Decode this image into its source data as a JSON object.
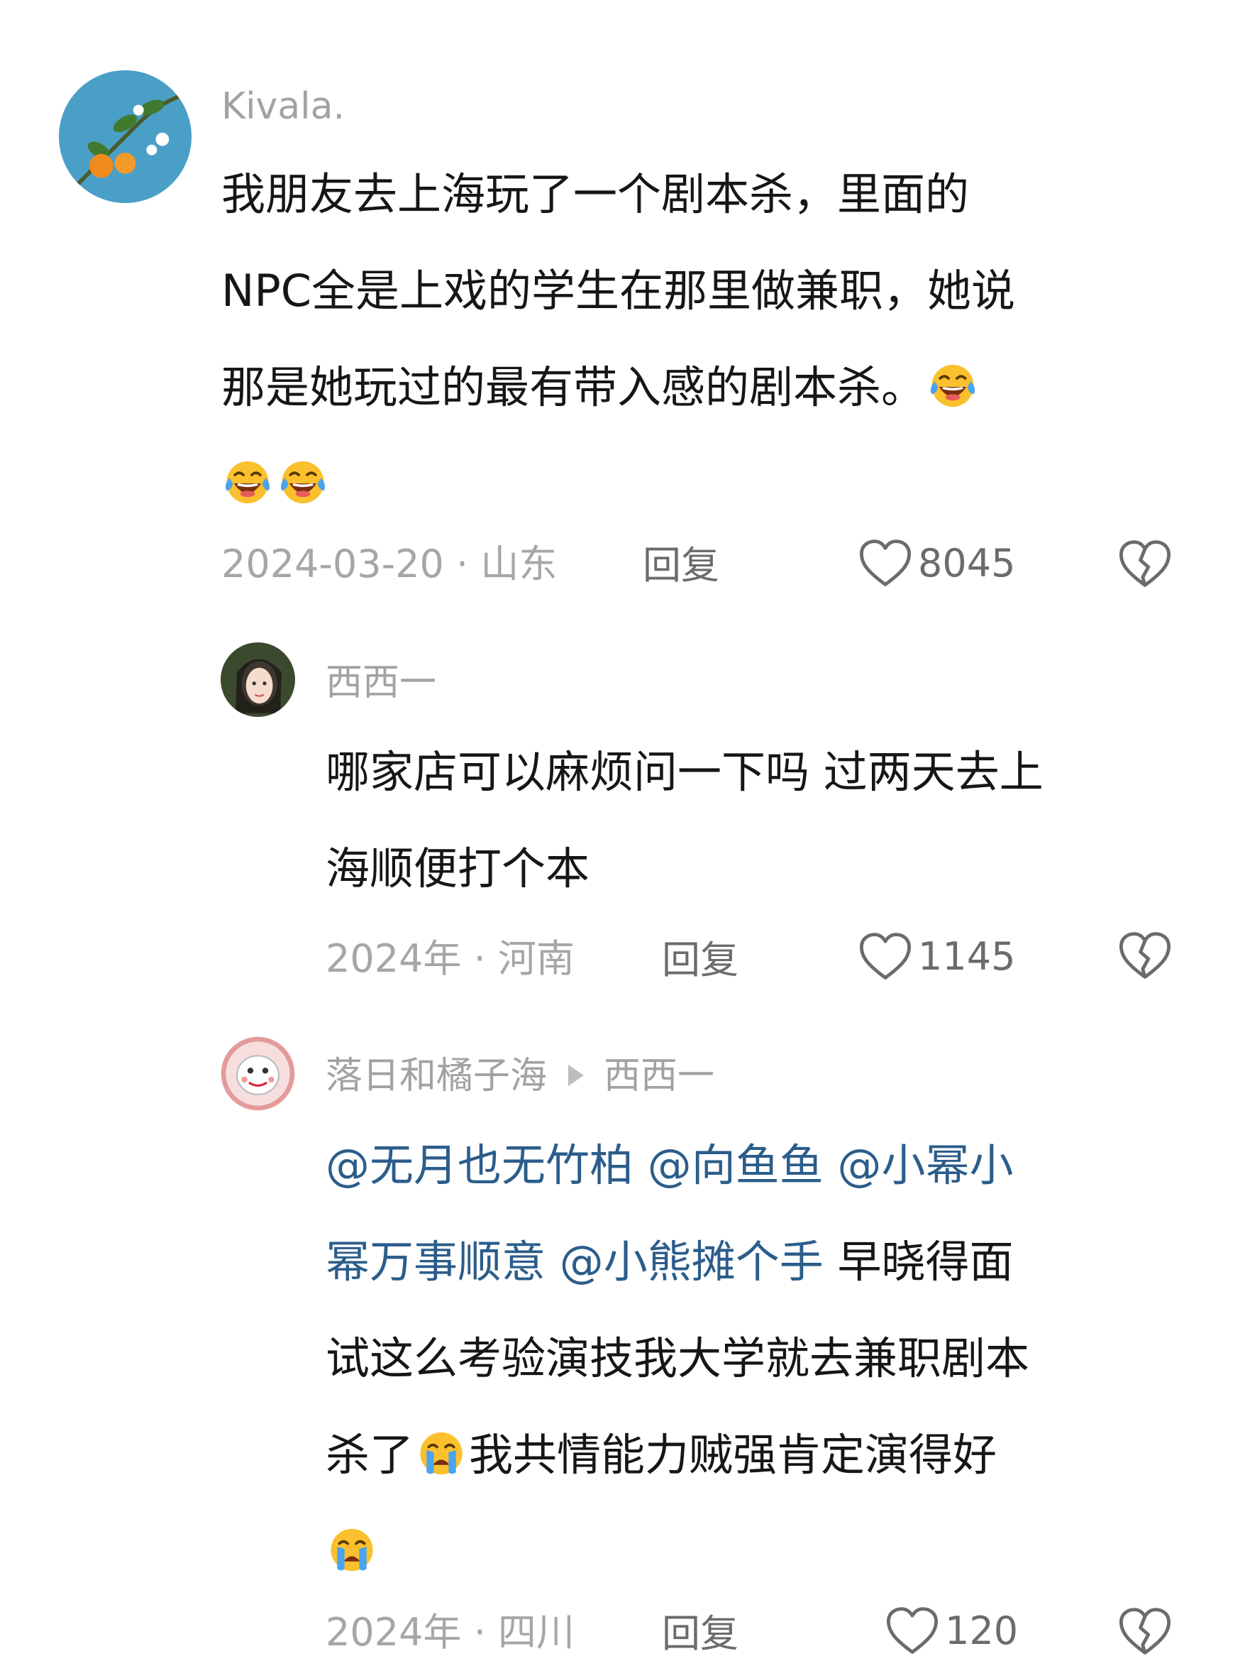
{
  "comments": [
    {
      "username": "Kivala.",
      "lines": [
        "我朋友去上海玩了一个剧本杀，里面的",
        "NPC全是上戏的学生在那里做兼职，她说",
        "那是她玩过的最有带入感的剧本杀。"
      ],
      "meta": "2024-03-20 · 山东",
      "reply_label": "回复",
      "likes": "8045",
      "emoji": [
        "laughing-tears",
        "laughing-tears",
        "laughing-tears"
      ]
    },
    {
      "username": "西西一",
      "lines": [
        "哪家店可以麻烦问一下吗 过两天去上",
        "海顺便打个本"
      ],
      "meta": "2024年 · 河南",
      "reply_label": "回复",
      "likes": "1145"
    },
    {
      "username": "落日和橘子海",
      "reply_to": "西西一",
      "mentions": [
        "@无月也无竹柏",
        "@向鱼鱼",
        "@小幂小",
        "幂万事顺意",
        "@小熊摊个手"
      ],
      "line2_tail": " 早晓得面",
      "line3": "试这么考验演技我大学就去兼职剧本",
      "line4_a": "杀了",
      "line4_b": "我共情能力贼强肯定演得好",
      "meta": "2024年 · 四川",
      "reply_label": "回复",
      "likes": "120",
      "emoji": [
        "crying",
        "crying"
      ]
    }
  ],
  "colors": {
    "text": "#161616",
    "username": "#a2a2a2",
    "meta": "#a6a6a6",
    "action": "#6b6b6b",
    "mention": "#2b5d8a"
  }
}
